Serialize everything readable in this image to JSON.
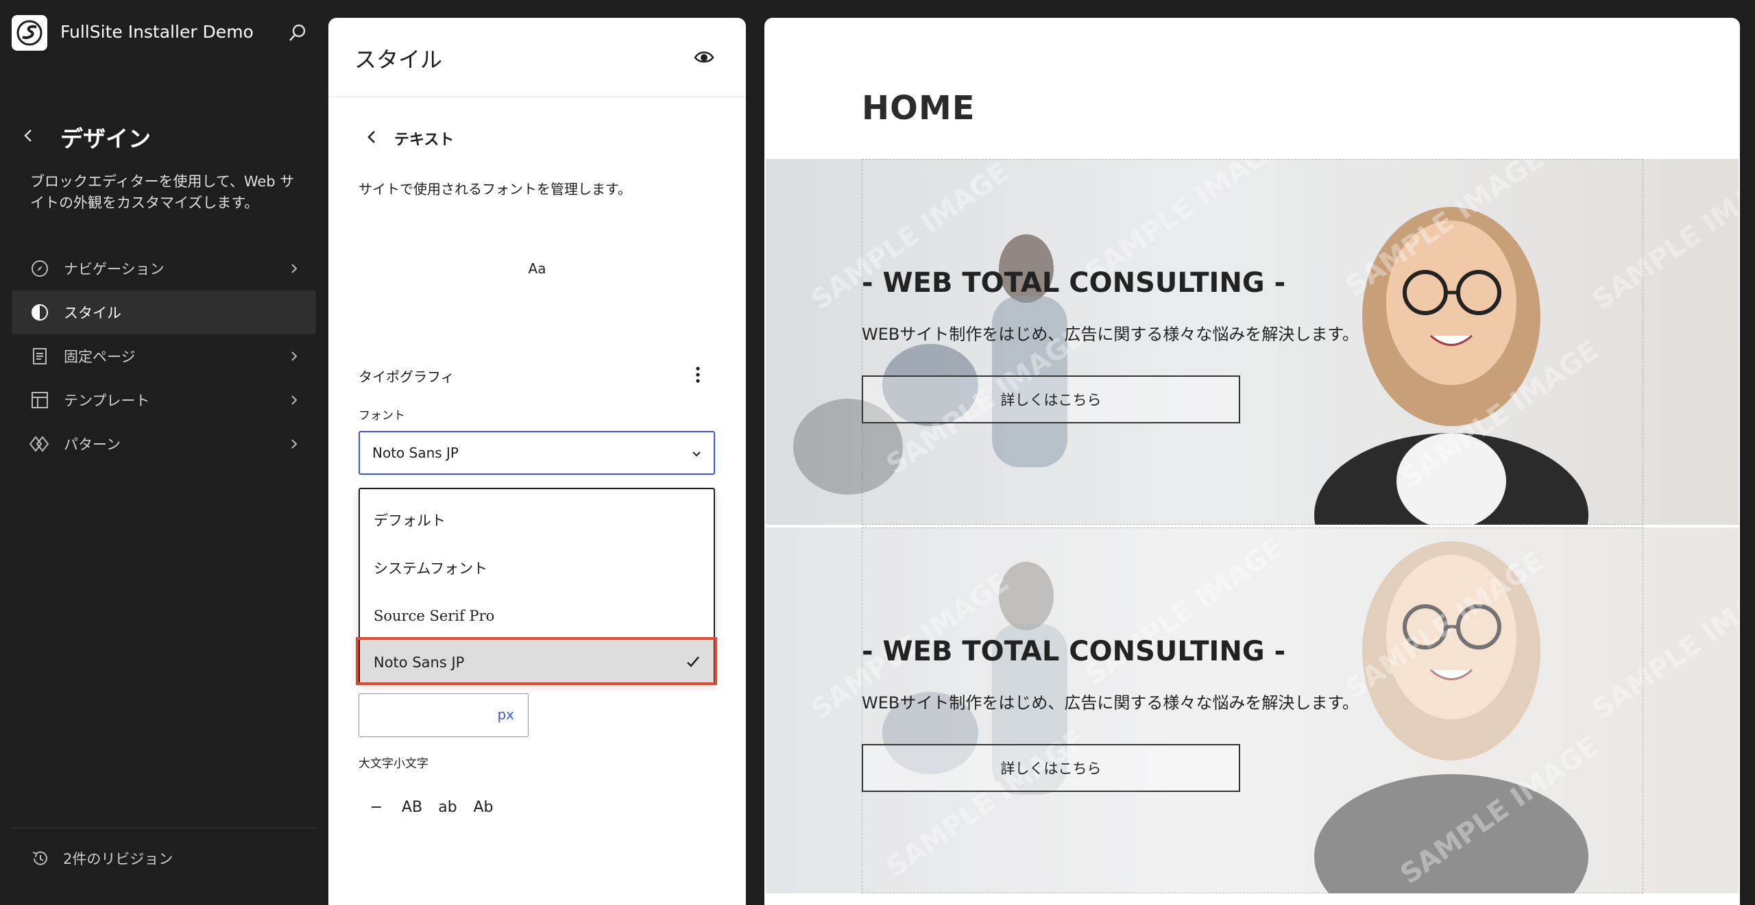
{
  "sidebar": {
    "site_title": "FullSite Installer Demo",
    "section_title": "デザイン",
    "description": "ブロックエディターを使用して、Web サイトの外観をカスタマイズします。",
    "items": [
      {
        "label": "ナビゲーション",
        "icon": "compass-icon"
      },
      {
        "label": "スタイル",
        "icon": "half-circle-icon"
      },
      {
        "label": "固定ページ",
        "icon": "page-icon"
      },
      {
        "label": "テンプレート",
        "icon": "layout-icon"
      },
      {
        "label": "パターン",
        "icon": "diamond-icon"
      }
    ],
    "active_item": "スタイル",
    "revisions": "2件のリビジョン"
  },
  "panel": {
    "title": "スタイル",
    "subtitle": "テキスト",
    "description": "サイトで使用されるフォントを管理します。",
    "preview_text": "Aa",
    "typography_label": "タイポグラフィ",
    "font_label": "フォント",
    "font_value": "Noto Sans JP",
    "font_options": [
      "デフォルト",
      "システムフォント",
      "Source Serif Pro",
      "Noto Sans JP"
    ],
    "size_unit": "px",
    "case_label": "大文字小文字",
    "case_options": [
      "−",
      "AB",
      "ab",
      "Ab"
    ],
    "highlight_color": "#e2492e",
    "accent_color": "#3858e9"
  },
  "canvas": {
    "page_title": "HOME",
    "heroes": [
      {
        "heading": "- WEB TOTAL CONSULTING -",
        "text": "WEBサイト制作をはじめ、広告に関する様々な悩みを解決します。",
        "button": "詳しくはこちら"
      },
      {
        "heading": "- WEB TOTAL CONSULTING -",
        "text": "WEBサイト制作をはじめ、広告に関する様々な悩みを解決します。",
        "button": "詳しくはこちら"
      }
    ],
    "watermark": "SAMPLE IMAGE"
  }
}
